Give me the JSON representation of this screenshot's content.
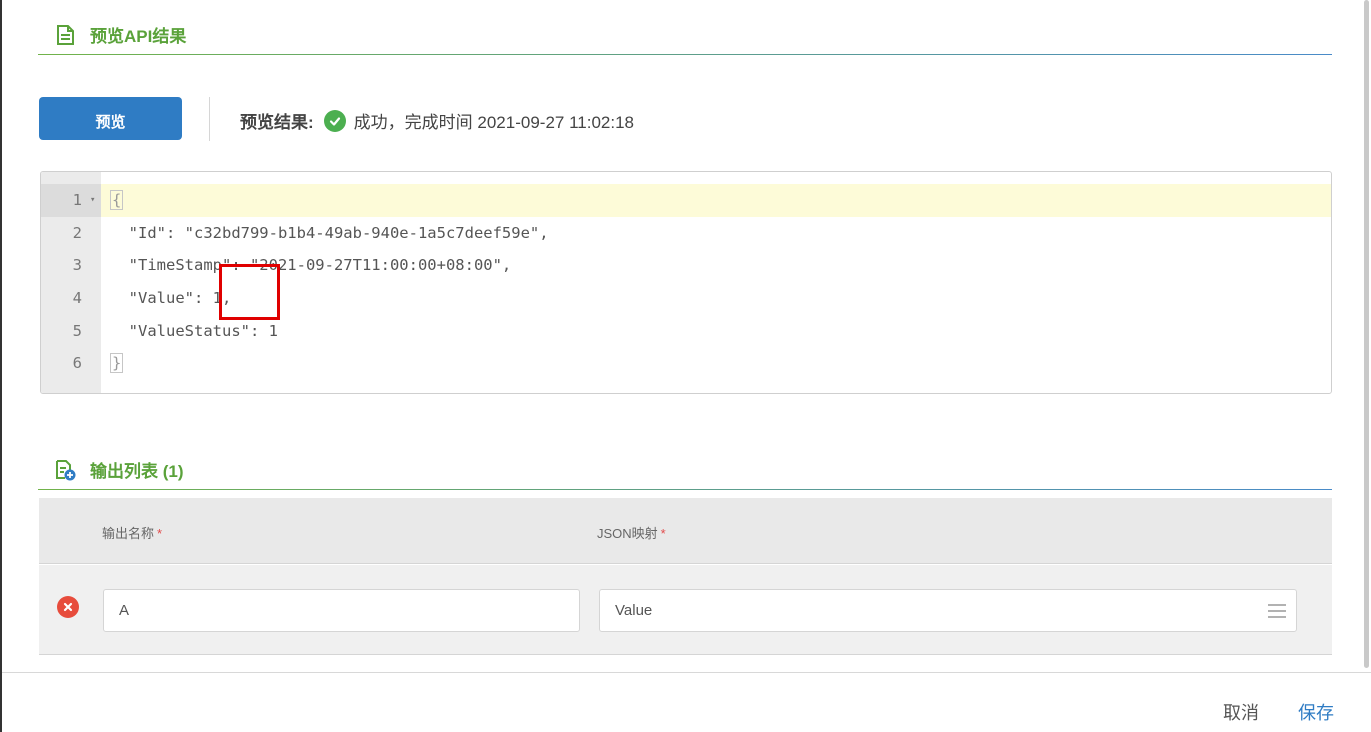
{
  "section_preview": {
    "title": "预览API结果"
  },
  "toolbar": {
    "preview_label": "预览",
    "result_label": "预览结果:",
    "result_text": "成功，完成时间 2021-09-27 11:02:18"
  },
  "editor": {
    "lines": [
      {
        "num": "1",
        "text": "{"
      },
      {
        "num": "2",
        "text": "  \"Id\": \"c32bd799-b1b4-49ab-940e-1a5c7deef59e\","
      },
      {
        "num": "3",
        "text": "  \"TimeStamp\": \"2021-09-27T11:00:00+08:00\","
      },
      {
        "num": "4",
        "text": "  \"Value\": 1,"
      },
      {
        "num": "5",
        "text": "  \"ValueStatus\": 1"
      },
      {
        "num": "6",
        "text": "}"
      }
    ]
  },
  "section_output": {
    "title": "输出列表 (1)"
  },
  "table": {
    "col_name": "输出名称",
    "col_json": "JSON映射",
    "required_mark": "*",
    "rows": [
      {
        "name": "A",
        "json": "Value"
      }
    ]
  },
  "footer": {
    "cancel_label": "取消",
    "save_label": "保存"
  },
  "colors": {
    "accent_green": "#5aa23a",
    "primary_blue": "#2f7cc4",
    "success": "#4caf50",
    "danger": "#e74c3c",
    "highlight_red": "#e00000"
  },
  "icons": {
    "preview_section": "document-icon",
    "output_section": "document-add-icon",
    "status": "check-circle-icon",
    "row_delete": "remove-circle-icon",
    "mapping_menu": "hamburger-menu-icon"
  }
}
